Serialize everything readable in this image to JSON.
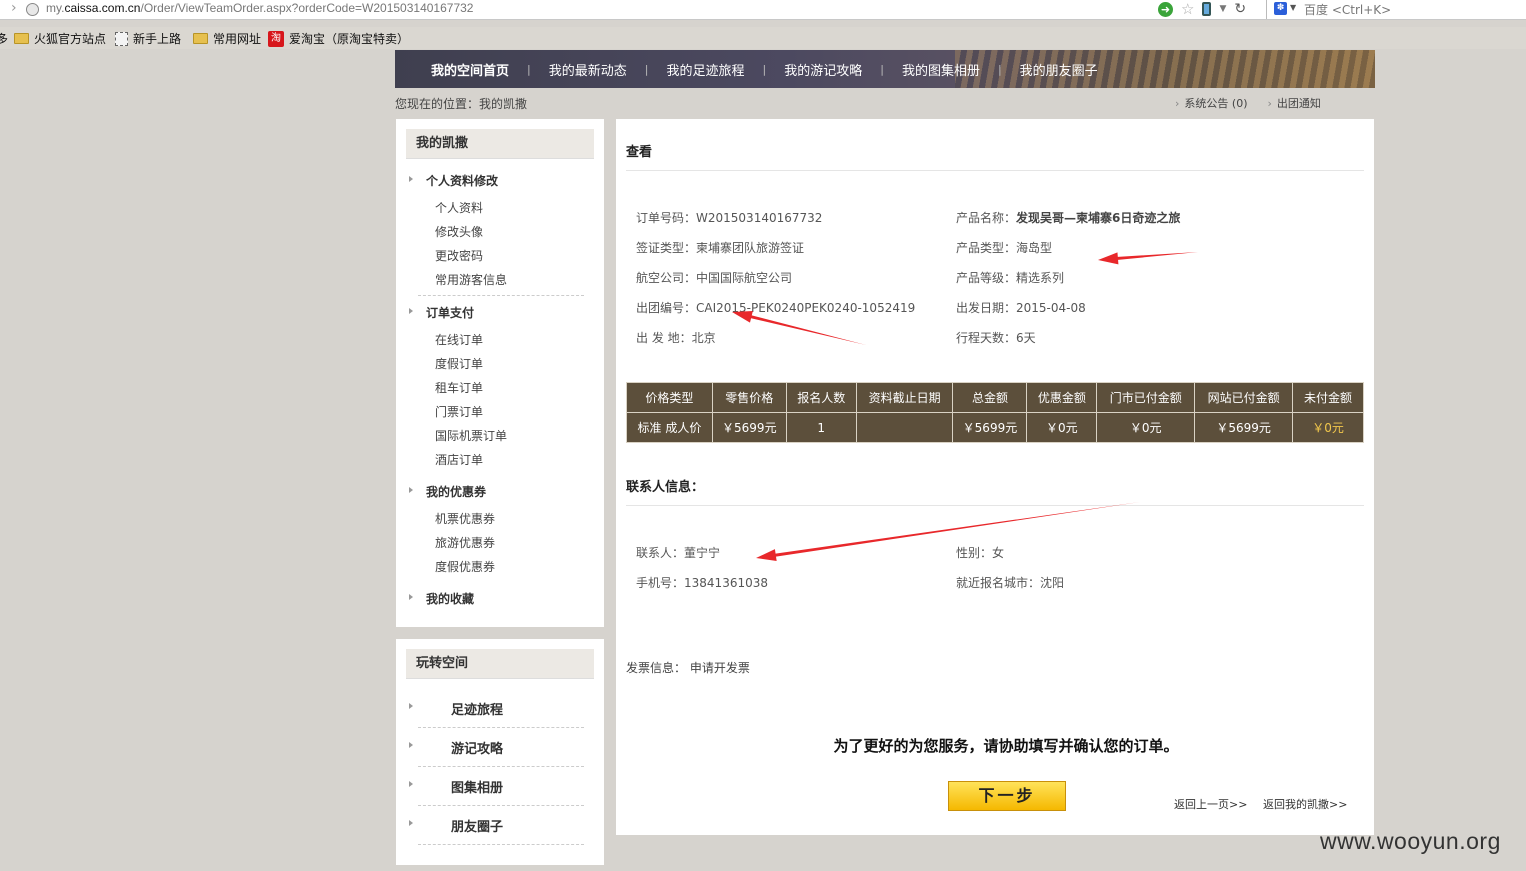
{
  "browser": {
    "url_prefix": "my.",
    "url_domain": "caissa.com.cn",
    "url_path": "/Order/ViewTeamOrder.aspx?orderCode=W201503140167732",
    "search_engine": "百度",
    "search_hint": "百度 <Ctrl+K>",
    "bookmarks": [
      "火狐官方站点",
      "新手上路",
      "常用网址",
      "爱淘宝（原淘宝特卖）"
    ],
    "bookmark_lead": "多",
    "tao_glyph": "淘"
  },
  "nav": {
    "items": [
      "我的空间首页",
      "我的最新动态",
      "我的足迹旅程",
      "我的游记攻略",
      "我的图集相册",
      "我的朋友圈子"
    ],
    "divider": "|"
  },
  "breadcrumb": "您现在的位置：我的凯撒",
  "notices": [
    "系统公告 (0)",
    "出团通知"
  ],
  "sidebar": {
    "title": "我的凯撒",
    "groups": [
      {
        "label": "个人资料修改",
        "items": [
          "个人资料",
          "修改头像",
          "更改密码",
          "常用游客信息"
        ]
      },
      {
        "label": "订单支付",
        "items": [
          "在线订单",
          "度假订单",
          "租车订单",
          "门票订单",
          "国际机票订单",
          "酒店订单"
        ]
      },
      {
        "label": "我的优惠券",
        "items": [
          "机票优惠券",
          "旅游优惠券",
          "度假优惠券"
        ]
      },
      {
        "label": "我的收藏",
        "items": []
      }
    ]
  },
  "play": {
    "title": "玩转空间",
    "items": [
      "足迹旅程",
      "游记攻略",
      "图集相册",
      "朋友圈子"
    ]
  },
  "main": {
    "heading": "查看",
    "order": {
      "order_no_label": "订单号码：",
      "order_no": "W201503140167732",
      "product_name_label": "产品名称：",
      "product_name": "发现吴哥—柬埔寨6日奇迹之旅",
      "visa_label": "签证类型：",
      "visa": "柬埔寨团队旅游签证",
      "product_type_label": "产品类型：",
      "product_type": "海岛型",
      "airline_label": "航空公司：",
      "airline": "中国国际航空公司",
      "grade_label": "产品等级：",
      "grade": "精选系列",
      "group_no_label": "出团编号：",
      "group_no": "CAI2015-PEK0240PEK0240-1052419",
      "depart_date_label": "出发日期：",
      "depart_date": "2015-04-08",
      "depart_city_label": "出 发 地：",
      "depart_city": "北京",
      "days_label": "行程天数：",
      "days": "6天"
    },
    "price_table": {
      "headers": [
        "价格类型",
        "零售价格",
        "报名人数",
        "资料截止日期",
        "总金额",
        "优惠金额",
        "门市已付金额",
        "网站已付金额",
        "未付金额"
      ],
      "row": [
        "标准 成人价",
        "￥5699元",
        "1",
        "",
        "￥5699元",
        "￥0元",
        "￥0元",
        "￥5699元",
        "￥0元"
      ]
    },
    "contact_heading": "联系人信息：",
    "contact": {
      "name_label": "联系人：",
      "name": "董宁宁",
      "gender_label": "性别：",
      "gender": "女",
      "phone_label": "手机号：",
      "phone": "13841361038",
      "city_label": "就近报名城市：",
      "city": "沈阳"
    },
    "invoice_label": "发票信息：",
    "invoice_value": "申请开发票",
    "prompt": "为了更好的为您服务，请协助填写并确认您的订单。",
    "next_button": "下一步",
    "back_prev": "返回上一页>>",
    "back_home": "返回我的凯撒>>"
  },
  "watermark": "www.wooyun.org",
  "annotation_color": "#e8282b"
}
